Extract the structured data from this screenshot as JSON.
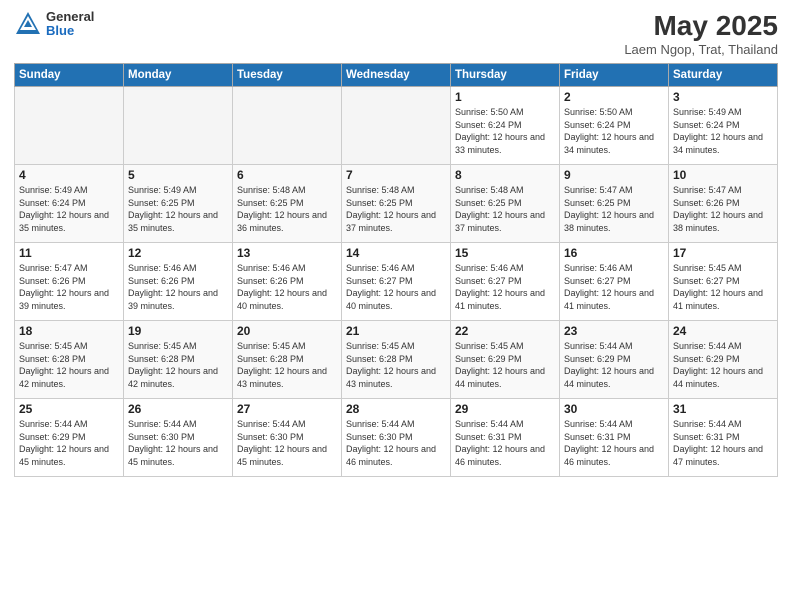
{
  "header": {
    "logo_general": "General",
    "logo_blue": "Blue",
    "title": "May 2025",
    "subtitle": "Laem Ngop, Trat, Thailand"
  },
  "days_of_week": [
    "Sunday",
    "Monday",
    "Tuesday",
    "Wednesday",
    "Thursday",
    "Friday",
    "Saturday"
  ],
  "weeks": [
    [
      {
        "day": "",
        "info": ""
      },
      {
        "day": "",
        "info": ""
      },
      {
        "day": "",
        "info": ""
      },
      {
        "day": "",
        "info": ""
      },
      {
        "day": "1",
        "info": "Sunrise: 5:50 AM\nSunset: 6:24 PM\nDaylight: 12 hours\nand 33 minutes."
      },
      {
        "day": "2",
        "info": "Sunrise: 5:50 AM\nSunset: 6:24 PM\nDaylight: 12 hours\nand 34 minutes."
      },
      {
        "day": "3",
        "info": "Sunrise: 5:49 AM\nSunset: 6:24 PM\nDaylight: 12 hours\nand 34 minutes."
      }
    ],
    [
      {
        "day": "4",
        "info": "Sunrise: 5:49 AM\nSunset: 6:24 PM\nDaylight: 12 hours\nand 35 minutes."
      },
      {
        "day": "5",
        "info": "Sunrise: 5:49 AM\nSunset: 6:25 PM\nDaylight: 12 hours\nand 35 minutes."
      },
      {
        "day": "6",
        "info": "Sunrise: 5:48 AM\nSunset: 6:25 PM\nDaylight: 12 hours\nand 36 minutes."
      },
      {
        "day": "7",
        "info": "Sunrise: 5:48 AM\nSunset: 6:25 PM\nDaylight: 12 hours\nand 37 minutes."
      },
      {
        "day": "8",
        "info": "Sunrise: 5:48 AM\nSunset: 6:25 PM\nDaylight: 12 hours\nand 37 minutes."
      },
      {
        "day": "9",
        "info": "Sunrise: 5:47 AM\nSunset: 6:25 PM\nDaylight: 12 hours\nand 38 minutes."
      },
      {
        "day": "10",
        "info": "Sunrise: 5:47 AM\nSunset: 6:26 PM\nDaylight: 12 hours\nand 38 minutes."
      }
    ],
    [
      {
        "day": "11",
        "info": "Sunrise: 5:47 AM\nSunset: 6:26 PM\nDaylight: 12 hours\nand 39 minutes."
      },
      {
        "day": "12",
        "info": "Sunrise: 5:46 AM\nSunset: 6:26 PM\nDaylight: 12 hours\nand 39 minutes."
      },
      {
        "day": "13",
        "info": "Sunrise: 5:46 AM\nSunset: 6:26 PM\nDaylight: 12 hours\nand 40 minutes."
      },
      {
        "day": "14",
        "info": "Sunrise: 5:46 AM\nSunset: 6:27 PM\nDaylight: 12 hours\nand 40 minutes."
      },
      {
        "day": "15",
        "info": "Sunrise: 5:46 AM\nSunset: 6:27 PM\nDaylight: 12 hours\nand 41 minutes."
      },
      {
        "day": "16",
        "info": "Sunrise: 5:46 AM\nSunset: 6:27 PM\nDaylight: 12 hours\nand 41 minutes."
      },
      {
        "day": "17",
        "info": "Sunrise: 5:45 AM\nSunset: 6:27 PM\nDaylight: 12 hours\nand 41 minutes."
      }
    ],
    [
      {
        "day": "18",
        "info": "Sunrise: 5:45 AM\nSunset: 6:28 PM\nDaylight: 12 hours\nand 42 minutes."
      },
      {
        "day": "19",
        "info": "Sunrise: 5:45 AM\nSunset: 6:28 PM\nDaylight: 12 hours\nand 42 minutes."
      },
      {
        "day": "20",
        "info": "Sunrise: 5:45 AM\nSunset: 6:28 PM\nDaylight: 12 hours\nand 43 minutes."
      },
      {
        "day": "21",
        "info": "Sunrise: 5:45 AM\nSunset: 6:28 PM\nDaylight: 12 hours\nand 43 minutes."
      },
      {
        "day": "22",
        "info": "Sunrise: 5:45 AM\nSunset: 6:29 PM\nDaylight: 12 hours\nand 44 minutes."
      },
      {
        "day": "23",
        "info": "Sunrise: 5:44 AM\nSunset: 6:29 PM\nDaylight: 12 hours\nand 44 minutes."
      },
      {
        "day": "24",
        "info": "Sunrise: 5:44 AM\nSunset: 6:29 PM\nDaylight: 12 hours\nand 44 minutes."
      }
    ],
    [
      {
        "day": "25",
        "info": "Sunrise: 5:44 AM\nSunset: 6:29 PM\nDaylight: 12 hours\nand 45 minutes."
      },
      {
        "day": "26",
        "info": "Sunrise: 5:44 AM\nSunset: 6:30 PM\nDaylight: 12 hours\nand 45 minutes."
      },
      {
        "day": "27",
        "info": "Sunrise: 5:44 AM\nSunset: 6:30 PM\nDaylight: 12 hours\nand 45 minutes."
      },
      {
        "day": "28",
        "info": "Sunrise: 5:44 AM\nSunset: 6:30 PM\nDaylight: 12 hours\nand 46 minutes."
      },
      {
        "day": "29",
        "info": "Sunrise: 5:44 AM\nSunset: 6:31 PM\nDaylight: 12 hours\nand 46 minutes."
      },
      {
        "day": "30",
        "info": "Sunrise: 5:44 AM\nSunset: 6:31 PM\nDaylight: 12 hours\nand 46 minutes."
      },
      {
        "day": "31",
        "info": "Sunrise: 5:44 AM\nSunset: 6:31 PM\nDaylight: 12 hours\nand 47 minutes."
      }
    ]
  ]
}
